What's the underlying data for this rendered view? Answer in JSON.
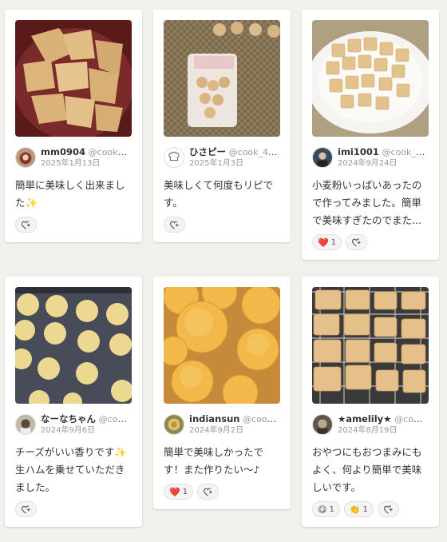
{
  "cards": [
    {
      "author": "mm0904",
      "id": "@cook_40...",
      "date": "2025年1月13日",
      "comment": "簡単に美味しく出来ました✨",
      "reactions": []
    },
    {
      "author": "ひさピー",
      "id": "@cook_40...",
      "date": "2025年1月3日",
      "comment": "美味しくて何度もリピです。",
      "reactions": []
    },
    {
      "author": "imi1001",
      "id": "@cook_412...",
      "date": "2024年9月24日",
      "comment": "小麦粉いっぱいあったので作ってみました。簡単で美味すぎたのでまた...",
      "reactions": [
        {
          "emoji": "❤️",
          "count": "1"
        }
      ]
    },
    {
      "author": "なーなちゃん",
      "id": "@cook...",
      "date": "2024年9月6日",
      "comment": "チーズがいい香りです✨生ハムを乗せていただきました。",
      "reactions": []
    },
    {
      "author": "indiansun",
      "id": "@cook_4...",
      "date": "2024年9月2日",
      "comment": "簡単で美味しかったです！また作りたい〜♪",
      "reactions": [
        {
          "emoji": "❤️",
          "count": "1"
        }
      ]
    },
    {
      "author": "★amelily★",
      "id": "@cook_...",
      "date": "2024年8月19日",
      "comment": "おやつにもおつまみにもよく、何より簡単で美味しいです。",
      "reactions": [
        {
          "emoji": "😋",
          "count": "1"
        },
        {
          "emoji": "👏",
          "count": "1"
        }
      ]
    }
  ],
  "icons": {
    "add_reaction": "heart-plus-icon",
    "default_avatar": "chef-hat-icon"
  }
}
